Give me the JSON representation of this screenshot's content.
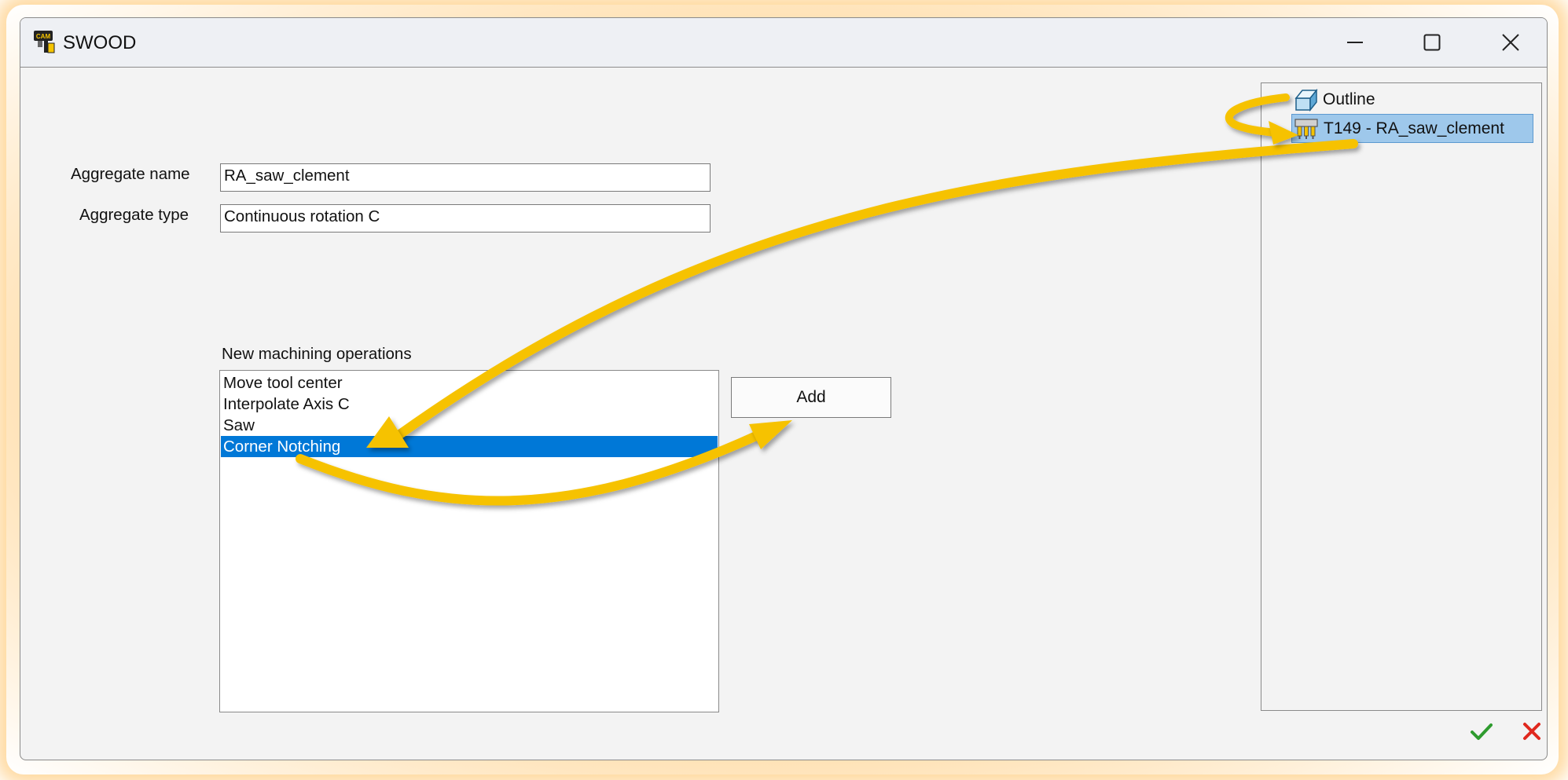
{
  "window": {
    "title": "SWOOD",
    "icon": "swood-cam-icon",
    "controls": [
      "minimize-icon",
      "maximize-icon",
      "close-icon"
    ]
  },
  "form": {
    "aggregate_name_label": "Aggregate name",
    "aggregate_name_value": "RA_saw_clement",
    "aggregate_type_label": "Aggregate type",
    "aggregate_type_value": "Continuous rotation C"
  },
  "operations": {
    "label": "New machining operations",
    "items": [
      "Move tool center",
      "Interpolate Axis C",
      "Saw",
      "Corner Notching"
    ],
    "selected": "Corner Notching",
    "add_label": "Add"
  },
  "tree": {
    "items": [
      {
        "label": "Outline",
        "icon": "outline-box-icon"
      },
      {
        "label": "T149 - RA_saw_clement",
        "icon": "aggregate-tool-icon",
        "selected": true
      }
    ]
  },
  "actions": {
    "ok_icon": "checkmark-icon",
    "cancel_icon": "cross-icon",
    "ok_color": "#2e9b2e",
    "cancel_color": "#e0281e"
  },
  "annotation_color": "#f6c200"
}
